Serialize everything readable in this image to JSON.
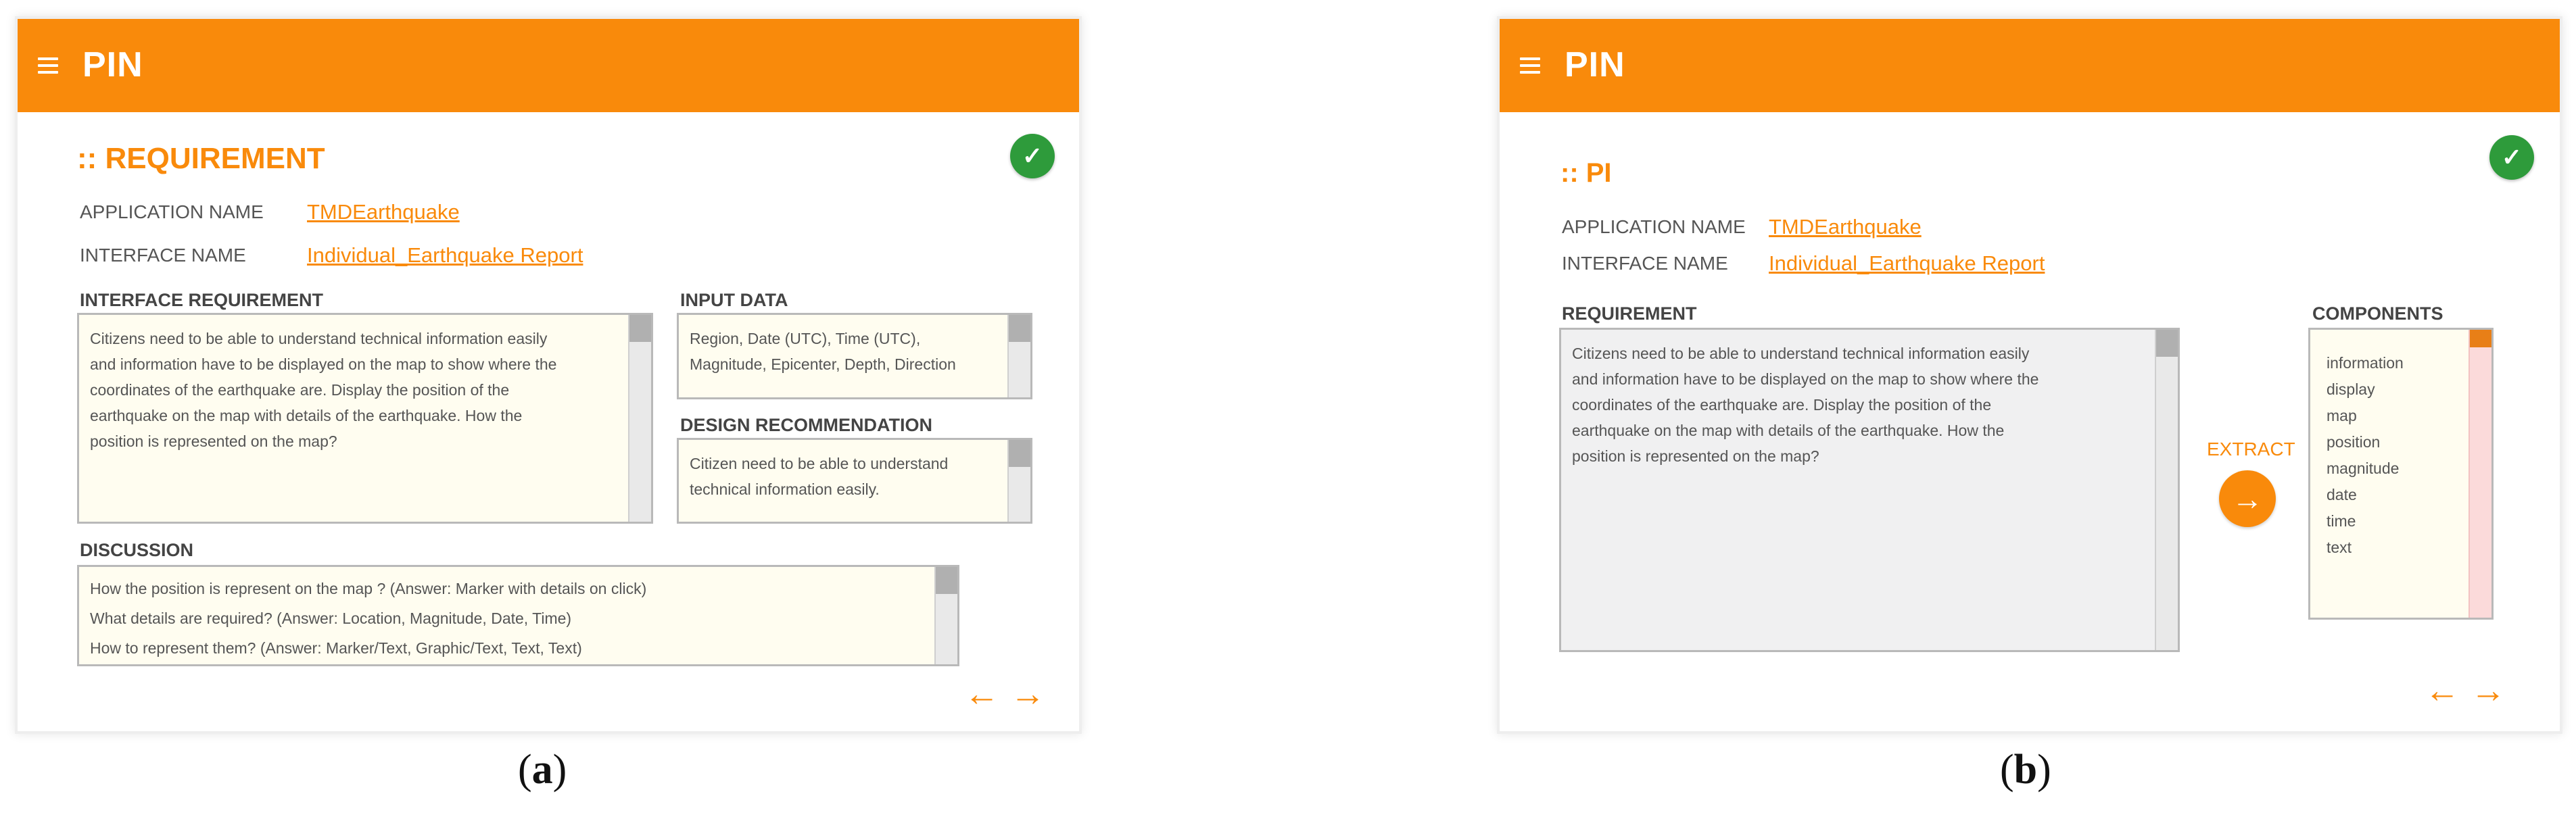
{
  "panel_a": {
    "app_title": "PIN",
    "section_title": ":: REQUIREMENT",
    "check_icon": "✓",
    "application_name_label": "APPLICATION NAME",
    "application_name_value": "TMDEarthquake",
    "interface_name_label": "INTERFACE NAME",
    "interface_name_value": "Individual_Earthquake Report",
    "interface_requirement_label": "INTERFACE REQUIREMENT",
    "interface_requirement_lines": [
      "Citizens need to be able to understand technical information easily",
      "and information have to be displayed on the map to show where the",
      "coordinates of the earthquake are.  Display the position of the",
      "earthquake on the map with details of the earthquake. How the",
      "position is represented on the map?"
    ],
    "input_data_label": "INPUT DATA",
    "input_data_lines": [
      "Region, Date (UTC), Time (UTC),",
      "Magnitude, Epicenter, Depth, Direction"
    ],
    "design_recommendation_label": "DESIGN RECOMMENDATION",
    "design_recommendation_lines": [
      "Citizen need to be able to understand",
      "technical information easily."
    ],
    "discussion_label": "DISCUSSION",
    "discussion_lines": [
      "How the position is represent on the map ? (Answer: Marker with details on click)",
      "What details are required? (Answer: Location, Magnitude, Date, Time)",
      "How to represent them? (Answer: Marker/Text, Graphic/Text, Text, Text)"
    ],
    "back_arrow": "←",
    "forward_arrow": "→",
    "caption_open": "(",
    "caption_letter": "a",
    "caption_close": ")"
  },
  "panel_b": {
    "app_title": "PIN",
    "section_title": ":: PI",
    "check_icon": "✓",
    "application_name_label": "APPLICATION NAME",
    "application_name_value": "TMDEarthquake",
    "interface_name_label": "INTERFACE NAME",
    "interface_name_value": "Individual_Earthquake Report",
    "requirement_label": "REQUIREMENT",
    "requirement_lines": [
      "Citizens need to be able to understand technical information easily",
      "and information have to be displayed on the map to show where the",
      "coordinates of the earthquake are.  Display the position of the",
      "earthquake on the map with details of the earthquake. How the",
      "position is represented on the map?"
    ],
    "extract_label": "EXTRACT",
    "extract_icon": "→",
    "components_label": "COMPONENTS",
    "components": [
      "information",
      "display",
      "map",
      "position",
      "magnitude",
      "date",
      "time",
      "text"
    ],
    "back_arrow": "←",
    "forward_arrow": "→",
    "caption_open": "(",
    "caption_letter": "b",
    "caption_close": ")"
  },
  "colors": {
    "accent": "#f98a0b",
    "check": "#2e9b3b",
    "textbox_bg": "#fffdf0",
    "gray_box_bg": "#f0f0f1"
  },
  "icons": {
    "menu": "hamburger-menu-icon",
    "check": "check-circle-icon",
    "back": "arrow-left-icon",
    "forward": "arrow-right-icon",
    "extract": "arrow-right-circle-icon"
  }
}
